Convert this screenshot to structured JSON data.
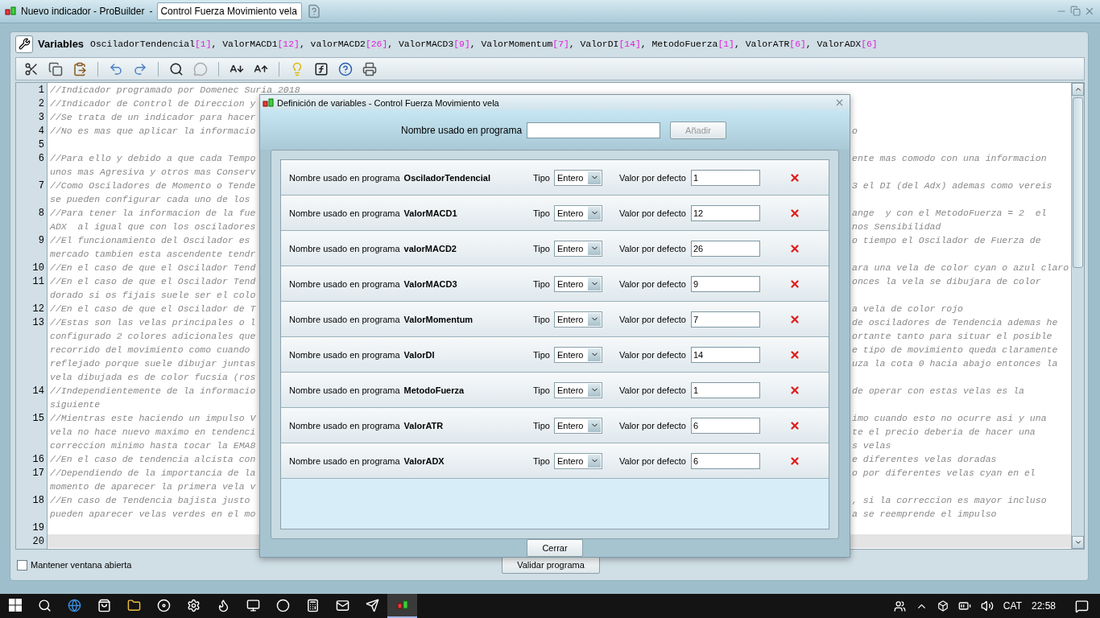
{
  "window": {
    "title": "Nuevo indicador - ProBuilder",
    "separator": "-",
    "name_field": "Control Fuerza Movimiento vela"
  },
  "variables": {
    "label": "Variables",
    "items": [
      {
        "name": "OsciladorTendencial",
        "value": "[1]",
        "separator": ","
      },
      {
        "name": "ValorMACD1",
        "value": "[12]",
        "separator": ","
      },
      {
        "name": "valorMACD2",
        "value": "[26]",
        "separator": ","
      },
      {
        "name": "ValorMACD3",
        "value": "[9]",
        "separator": ","
      },
      {
        "name": "ValorMomentum",
        "value": "[7]",
        "separator": ","
      },
      {
        "name": "ValorDI",
        "value": "[14]",
        "separator": ","
      },
      {
        "name": "MetodoFuerza",
        "value": "[1]",
        "separator": ","
      },
      {
        "name": "ValorATR",
        "value": "[6]",
        "separator": ","
      },
      {
        "name": "ValorADX",
        "value": "[6]"
      }
    ]
  },
  "toolbar": [
    {
      "kind": "cut"
    },
    {
      "kind": "copy"
    },
    {
      "kind": "paste"
    },
    {
      "kind": "sep"
    },
    {
      "kind": "undo"
    },
    {
      "kind": "redo"
    },
    {
      "kind": "sep"
    },
    {
      "kind": "search"
    },
    {
      "kind": "comment"
    },
    {
      "kind": "sep"
    },
    {
      "kind": "font_smaller"
    },
    {
      "kind": "font_larger"
    },
    {
      "kind": "sep"
    },
    {
      "kind": "tip"
    },
    {
      "kind": "function"
    },
    {
      "kind": "help"
    },
    {
      "kind": "print"
    }
  ],
  "code_lines": [
    {
      "number": "1",
      "current": false,
      "rows": [
        {
          "left": "//Indicador programado por Domenec Suria 2018"
        }
      ]
    },
    {
      "number": "2",
      "current": false,
      "rows": [
        {
          "left": "//Indicador de Control de Direccion y"
        }
      ]
    },
    {
      "number": "3",
      "current": false,
      "rows": [
        {
          "left": "//Se trata de un indicador para hacer"
        }
      ]
    },
    {
      "number": "4",
      "current": false,
      "rows": [
        {
          "left": "//No es mas que aplicar la informacio",
          "right": "o"
        }
      ]
    },
    {
      "number": "5",
      "current": false,
      "rows": [
        {
          "left": ""
        }
      ]
    },
    {
      "number": "6",
      "current": false,
      "rows": [
        {
          "left": "//Para ello y debido a que cada Tempo",
          "right": "ente mas comodo con una informacion"
        },
        {
          "left": "unos mas Agresiva y otros mas Conserv"
        }
      ]
    },
    {
      "number": "7",
      "current": false,
      "rows": [
        {
          "left": "//Como Osciladores de Momento o Tende",
          "right": "3 el DI (del Adx) ademas como vereis"
        },
        {
          "left": "se pueden configurar cada uno de los"
        }
      ]
    },
    {
      "number": "8",
      "current": false,
      "rows": [
        {
          "left": "//Para tener la informacion de la fue",
          "right": "ange  y con el MetodoFuerza = 2  el"
        },
        {
          "left": "ADX  al igual que con los osciladores",
          "right": "nos Sensibilidad"
        }
      ]
    },
    {
      "number": "9",
      "current": false,
      "rows": [
        {
          "left": "//El funcionamiento del Oscilador es",
          "right": "o tiempo el Oscilador de Fuerza de"
        },
        {
          "left": "mercado tambien esta ascendente tendr"
        }
      ]
    },
    {
      "number": "10",
      "current": false,
      "rows": [
        {
          "left": "//En el caso de que el Oscilador Tend",
          "right": "ara una vela de color cyan o azul claro"
        }
      ]
    },
    {
      "number": "11",
      "current": false,
      "rows": [
        {
          "left": "//En el caso de que el Oscilador Tend",
          "right": "onces la vela se dibujara de color"
        },
        {
          "left": "dorado si os fijais suele ser el colo"
        }
      ]
    },
    {
      "number": "12",
      "current": false,
      "rows": [
        {
          "left": "//En el caso de que el Oscilador de T",
          "right": "a vela de color rojo"
        }
      ]
    },
    {
      "number": "13",
      "current": false,
      "rows": [
        {
          "left": "//Estas son las velas principales o l",
          "right": "de osciladores de Tendencia ademas he"
        },
        {
          "left": "configurado 2 colores adicionales que",
          "right": "ortante tanto para situar el posible"
        },
        {
          "left": "recorrido del movimiento como cuando",
          "right": "e tipo de movimiento queda claramente"
        },
        {
          "left": "reflejado porque suele dibujar juntas",
          "right": "uza la cota 0 hacia abajo entonces la"
        },
        {
          "left": "vela dibujada es de color fucsia (ros"
        }
      ]
    },
    {
      "number": "14",
      "current": false,
      "rows": [
        {
          "left": "//Independientemente de la informacio",
          "right": "de operar con estas velas es la"
        },
        {
          "left": "siguiente"
        }
      ]
    },
    {
      "number": "15",
      "current": false,
      "rows": [
        {
          "left": "//Mientras este haciendo un impulso V",
          "right": "imo cuando esto no ocurre asi y una"
        },
        {
          "left": "vela no hace nuevo maximo en tendenci",
          "right": "te el precio deberia de hacer una"
        },
        {
          "left": "correccion minimo hasta tocar la EMA8",
          "right": "s velas"
        }
      ]
    },
    {
      "number": "16",
      "current": false,
      "rows": [
        {
          "left": "//En el caso de tendencia alcista con",
          "right": "e diferentes velas doradas"
        }
      ]
    },
    {
      "number": "17",
      "current": false,
      "rows": [
        {
          "left": "//Dependiendo de la importancia de la",
          "right": "o por diferentes velas cyan en el"
        },
        {
          "left": "momento de aparecer la primera vela v"
        }
      ]
    },
    {
      "number": "18",
      "current": false,
      "rows": [
        {
          "left": "//En caso de Tendencia bajista justo",
          "right": ", si la correccion es mayor incluso"
        },
        {
          "left": "pueden aparecer velas verdes en el mo",
          "right": "a se reemprende el impulso"
        }
      ]
    },
    {
      "number": "19",
      "current": false,
      "rows": [
        {
          "left": ""
        }
      ]
    },
    {
      "number": "20",
      "current": true,
      "rows": [
        {
          "left": ""
        }
      ]
    }
  ],
  "keep_open": {
    "label": "Mantener ventana abierta",
    "checked": false
  },
  "validate_button": "Validar programa",
  "dialog": {
    "title": "Definición de variables - Control Fuerza Movimiento vela",
    "new_label": "Nombre usado en programa",
    "add_button": "Añadir",
    "add_disabled": true,
    "rows": [
      {
        "label": "Nombre usado en programa",
        "name": "OsciladorTendencial",
        "type_label": "Tipo",
        "type": "Entero",
        "default_label": "Valor por defecto",
        "value": "1"
      },
      {
        "label": "Nombre usado en programa",
        "name": "ValorMACD1",
        "type_label": "Tipo",
        "type": "Entero",
        "default_label": "Valor por defecto",
        "value": "12"
      },
      {
        "label": "Nombre usado en programa",
        "name": "valorMACD2",
        "type_label": "Tipo",
        "type": "Entero",
        "default_label": "Valor por defecto",
        "value": "26"
      },
      {
        "label": "Nombre usado en programa",
        "name": "ValorMACD3",
        "type_label": "Tipo",
        "type": "Entero",
        "default_label": "Valor por defecto",
        "value": "9"
      },
      {
        "label": "Nombre usado en programa",
        "name": "ValorMomentum",
        "type_label": "Tipo",
        "type": "Entero",
        "default_label": "Valor por defecto",
        "value": "7"
      },
      {
        "label": "Nombre usado en programa",
        "name": "ValorDI",
        "type_label": "Tipo",
        "type": "Entero",
        "default_label": "Valor por defecto",
        "value": "14"
      },
      {
        "label": "Nombre usado en programa",
        "name": "MetodoFuerza",
        "type_label": "Tipo",
        "type": "Entero",
        "default_label": "Valor por defecto",
        "value": "1"
      },
      {
        "label": "Nombre usado en programa",
        "name": "ValorATR",
        "type_label": "Tipo",
        "type": "Entero",
        "default_label": "Valor por defecto",
        "value": "6"
      },
      {
        "label": "Nombre usado en programa",
        "name": "ValorADX",
        "type_label": "Tipo",
        "type": "Entero",
        "default_label": "Valor por defecto",
        "value": "6"
      }
    ],
    "close_button": "Cerrar"
  },
  "taskbar": {
    "apps": [
      {
        "kind": "search",
        "selected": false
      },
      {
        "kind": "browser",
        "selected": false
      },
      {
        "kind": "store",
        "selected": false
      },
      {
        "kind": "folder",
        "selected": false
      },
      {
        "kind": "media",
        "selected": false
      },
      {
        "kind": "settings",
        "selected": false
      },
      {
        "kind": "firefox",
        "selected": false
      },
      {
        "kind": "monitor",
        "selected": false
      },
      {
        "kind": "chrome",
        "selected": false
      },
      {
        "kind": "calculator",
        "selected": false
      },
      {
        "kind": "mail",
        "selected": false
      },
      {
        "kind": "app",
        "selected": false
      },
      {
        "kind": "probuilder",
        "selected": true
      }
    ],
    "language": "CAT",
    "time": "22:58"
  }
}
